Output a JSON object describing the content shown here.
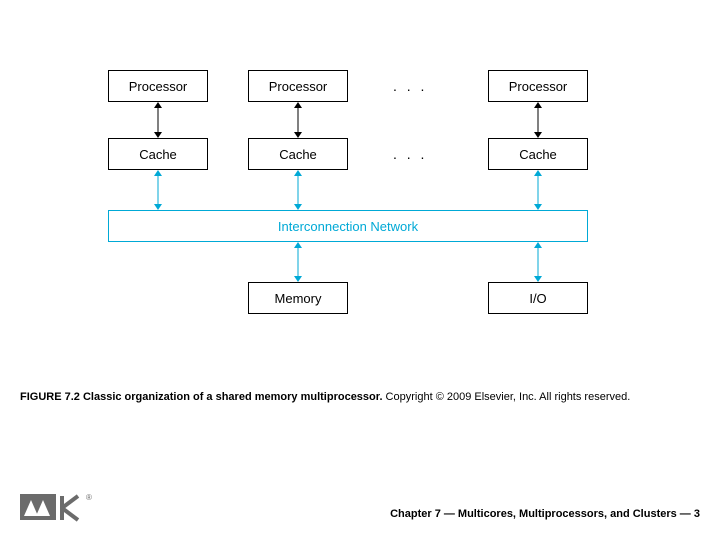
{
  "diagram": {
    "processors": [
      "Processor",
      "Processor",
      "Processor"
    ],
    "caches": [
      "Cache",
      "Cache",
      "Cache"
    ],
    "ellipsis": ". . .",
    "interconnect": "Interconnection Network",
    "memory": "Memory",
    "io": "I/O"
  },
  "caption": {
    "figlabel": "FIGURE 7.2 Classic organization of a shared memory multiprocessor.",
    "copyright": " Copyright © 2009 Elsevier, Inc. All rights reserved."
  },
  "footer": "Chapter 7 — Multicores, Multiprocessors, and Clusters — 3"
}
